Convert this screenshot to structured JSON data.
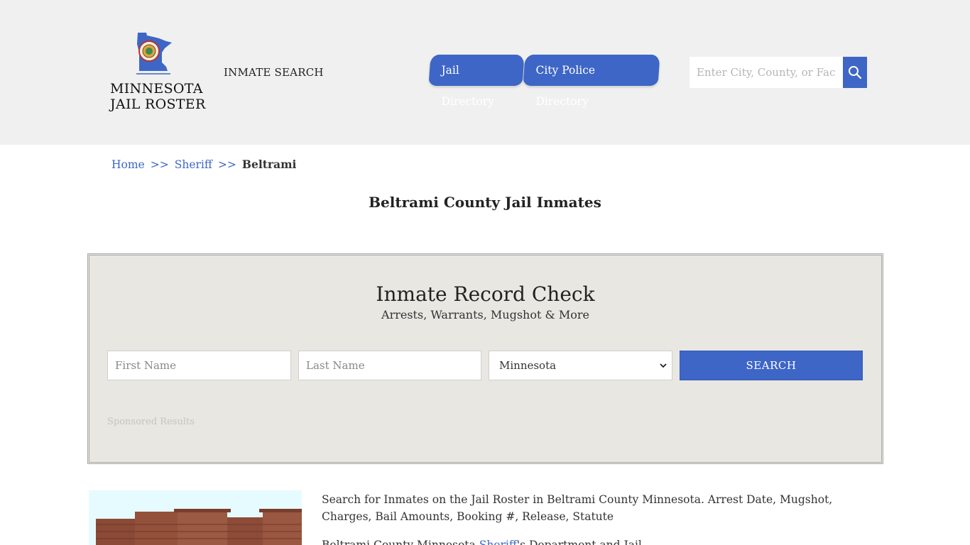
{
  "header": {
    "logo_line1": "MINNESOTA",
    "logo_line2": "JAIL ROSTER",
    "inmate_search": "INMATE SEARCH",
    "nav": [
      {
        "label": "Jail Directory"
      },
      {
        "label": "City Police Directory"
      }
    ],
    "search": {
      "placeholder": "Enter City, County, or Facility"
    }
  },
  "breadcrumb": {
    "home": "Home",
    "sep1": ">>",
    "sheriff": "Sheriff",
    "sep2": ">>",
    "current": "Beltrami"
  },
  "page_title": "Beltrami County Jail Inmates",
  "record_check": {
    "title": "Inmate Record Check",
    "subtitle": "Arrests, Warrants, Mugshot & More",
    "first_name_placeholder": "First Name",
    "last_name_placeholder": "Last Name",
    "state_selected": "Minnesota",
    "search_button": "SEARCH",
    "sponsored": "Sponsored Results"
  },
  "content": {
    "paragraph1": "Search for Inmates on the Jail Roster in Beltrami County Minnesota. Arrest Date, Mugshot, Charges, Bail Amounts, Booking #, Release, Statute",
    "paragraph2_start": "Beltrami County Minnesota ",
    "paragraph2_link": "Sheriff",
    "paragraph2_end": "'s Department and Jail"
  },
  "colors": {
    "accent": "#3e66c6",
    "header_bg": "#f0f0f0",
    "panel_bg": "#e9e7e2"
  }
}
